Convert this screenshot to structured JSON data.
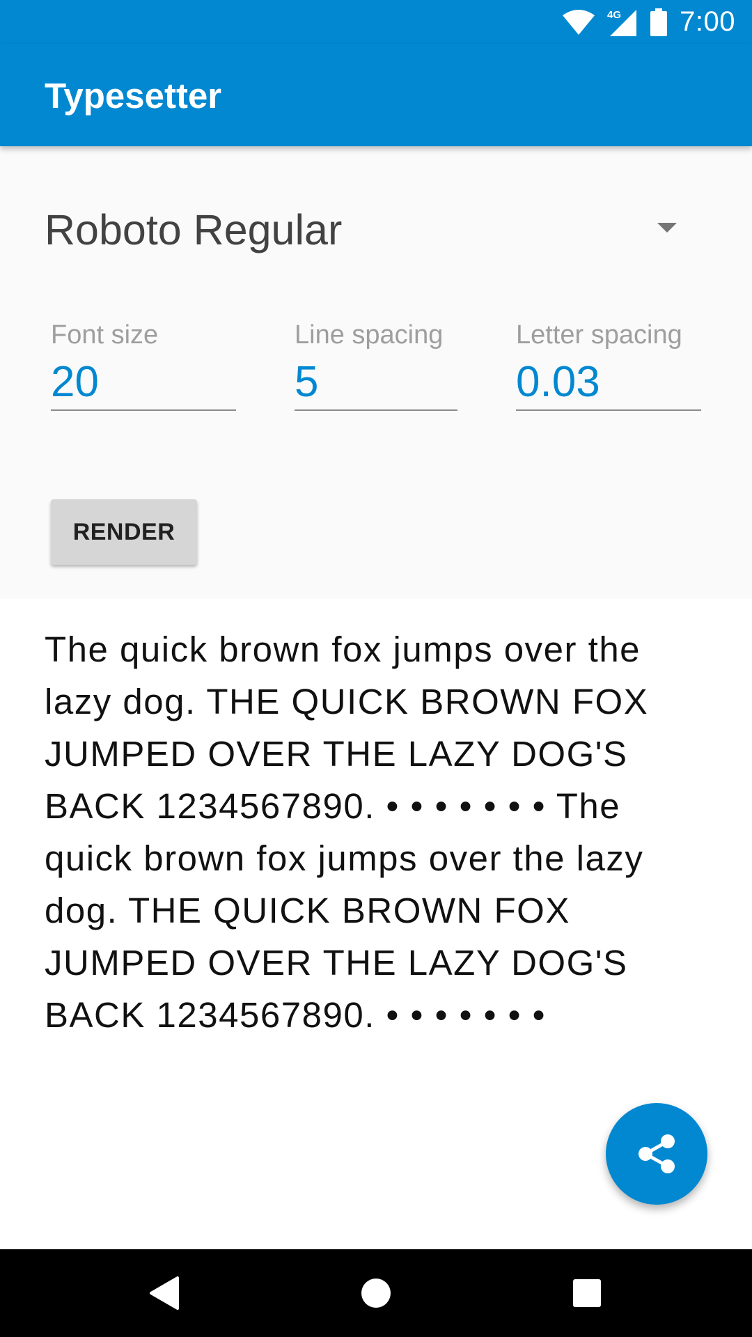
{
  "status_bar": {
    "time": "7:00",
    "network_label": "4G",
    "icons": [
      "wifi-icon",
      "cell-signal-icon",
      "battery-icon"
    ]
  },
  "app_bar": {
    "title": "Typesetter"
  },
  "controls": {
    "font_selector": {
      "selected": "Roboto Regular",
      "icon": "dropdown-arrow-icon"
    },
    "fields": {
      "font_size": {
        "label": "Font size",
        "value": "20"
      },
      "line_spacing": {
        "label": "Line spacing",
        "value": "5"
      },
      "letter_spacing": {
        "label": "Letter spacing",
        "value": "0.03"
      }
    },
    "render_label": "RENDER"
  },
  "preview": {
    "text": "The quick brown fox jumps over the lazy dog. THE QUICK BROWN FOX JUMPED OVER THE LAZY DOG'S BACK 1234567890. • • • • • • • The quick brown fox jumps over the lazy dog. THE QUICK BROWN FOX JUMPED OVER THE LAZY DOG'S BACK 1234567890. • • • • • • •"
  },
  "fab": {
    "icon": "share-icon"
  },
  "nav_bar": {
    "icons": [
      "back-icon",
      "home-icon",
      "recents-icon"
    ]
  },
  "colors": {
    "primary": "#0288D1",
    "panel_background": "#FAFAFA",
    "button_background": "#D6D6D6",
    "text_primary": "#111111",
    "label_gray": "#9E9E9E"
  }
}
